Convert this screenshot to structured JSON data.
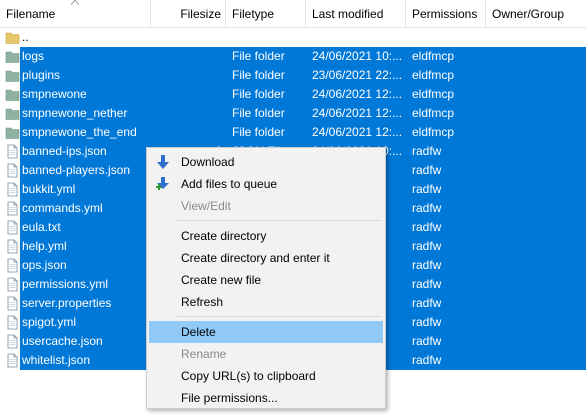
{
  "columns": {
    "filename": "Filename",
    "filesize": "Filesize",
    "filetype": "Filetype",
    "last_modified": "Last modified",
    "permissions": "Permissions",
    "owner_group": "Owner/Group"
  },
  "rows": [
    {
      "name": "..",
      "size": "",
      "type": "",
      "modified": "",
      "perms": "",
      "owner": "",
      "kind": "folder",
      "selected": false
    },
    {
      "name": "logs",
      "size": "",
      "type": "File folder",
      "modified": "24/06/2021 10:...",
      "perms": "eldfmcp",
      "owner": "",
      "kind": "folder",
      "selected": true
    },
    {
      "name": "plugins",
      "size": "",
      "type": "File folder",
      "modified": "23/06/2021 22:...",
      "perms": "eldfmcp",
      "owner": "",
      "kind": "folder",
      "selected": true
    },
    {
      "name": "smpnewone",
      "size": "",
      "type": "File folder",
      "modified": "24/06/2021 12:...",
      "perms": "eldfmcp",
      "owner": "",
      "kind": "folder",
      "selected": true
    },
    {
      "name": "smpnewone_nether",
      "size": "",
      "type": "File folder",
      "modified": "24/06/2021 12:...",
      "perms": "eldfmcp",
      "owner": "",
      "kind": "folder",
      "selected": true
    },
    {
      "name": "smpnewone_the_end",
      "size": "",
      "type": "File folder",
      "modified": "24/06/2021 12:...",
      "perms": "eldfmcp",
      "owner": "",
      "kind": "folder",
      "selected": true
    },
    {
      "name": "banned-ips.json",
      "size": "2",
      "type": "JSON File",
      "modified": "24/06/2021 10:...",
      "perms": "radfw",
      "owner": "",
      "kind": "file",
      "selected": true
    },
    {
      "name": "banned-players.json",
      "size": "",
      "type": "",
      "modified": "",
      "perms": "radfw",
      "owner": "",
      "kind": "file",
      "selected": true
    },
    {
      "name": "bukkit.yml",
      "size": "",
      "type": "",
      "modified": "",
      "perms": "radfw",
      "owner": "",
      "kind": "file",
      "selected": true
    },
    {
      "name": "commands.yml",
      "size": "",
      "type": "",
      "modified": "",
      "perms": "radfw",
      "owner": "",
      "kind": "file",
      "selected": true
    },
    {
      "name": "eula.txt",
      "size": "",
      "type": "",
      "modified": "",
      "perms": "radfw",
      "owner": "",
      "kind": "file",
      "selected": true
    },
    {
      "name": "help.yml",
      "size": "",
      "type": "",
      "modified": "",
      "perms": "radfw",
      "owner": "",
      "kind": "file",
      "selected": true
    },
    {
      "name": "ops.json",
      "size": "",
      "type": "",
      "modified": "",
      "perms": "radfw",
      "owner": "",
      "kind": "file",
      "selected": true
    },
    {
      "name": "permissions.yml",
      "size": "",
      "type": "",
      "modified": "",
      "perms": "radfw",
      "owner": "",
      "kind": "file",
      "selected": true
    },
    {
      "name": "server.properties",
      "size": "",
      "type": "",
      "modified": "",
      "perms": "radfw",
      "owner": "",
      "kind": "file",
      "selected": true
    },
    {
      "name": "spigot.yml",
      "size": "",
      "type": "",
      "modified": "",
      "perms": "radfw",
      "owner": "",
      "kind": "file",
      "selected": true
    },
    {
      "name": "usercache.json",
      "size": "",
      "type": "",
      "modified": "",
      "perms": "radfw",
      "owner": "",
      "kind": "file",
      "selected": true
    },
    {
      "name": "whitelist.json",
      "size": "",
      "type": "",
      "modified": "",
      "perms": "radfw",
      "owner": "",
      "kind": "file",
      "selected": true
    }
  ],
  "menu": [
    {
      "label": "Download",
      "icon": "download-arrow-icon",
      "enabled": true,
      "highlighted": false
    },
    {
      "label": "Add files to queue",
      "icon": "add-to-queue-icon",
      "enabled": true,
      "highlighted": false
    },
    {
      "label": "View/Edit",
      "icon": "",
      "enabled": false,
      "highlighted": false
    },
    {
      "separator": true
    },
    {
      "label": "Create directory",
      "icon": "",
      "enabled": true,
      "highlighted": false
    },
    {
      "label": "Create directory and enter it",
      "icon": "",
      "enabled": true,
      "highlighted": false
    },
    {
      "label": "Create new file",
      "icon": "",
      "enabled": true,
      "highlighted": false
    },
    {
      "label": "Refresh",
      "icon": "",
      "enabled": true,
      "highlighted": false
    },
    {
      "separator": true
    },
    {
      "label": "Delete",
      "icon": "",
      "enabled": true,
      "highlighted": true
    },
    {
      "label": "Rename",
      "icon": "",
      "enabled": false,
      "highlighted": false
    },
    {
      "label": "Copy URL(s) to clipboard",
      "icon": "",
      "enabled": true,
      "highlighted": false
    },
    {
      "label": "File permissions...",
      "icon": "",
      "enabled": true,
      "highlighted": false
    }
  ],
  "colors": {
    "selection": "#0078d7",
    "menu_highlight": "#91c9f7",
    "folder": "#e8c66a",
    "folder_selected": "#8fb3a0",
    "download_arrow": "#2f6fcf",
    "add_plus": "#2e9c3f"
  }
}
